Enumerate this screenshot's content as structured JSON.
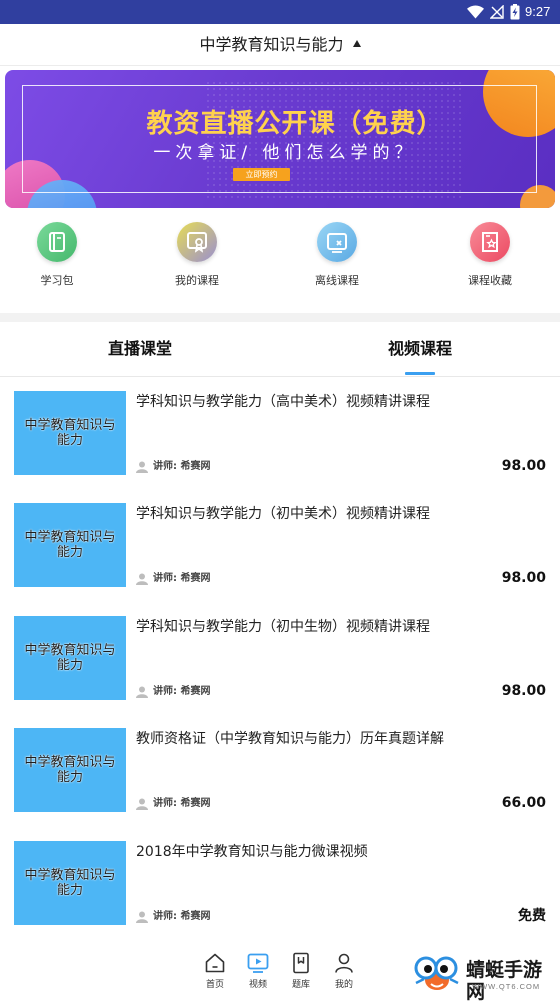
{
  "status_bar": {
    "time": "9:27",
    "icons": [
      "wifi-icon",
      "no-signal-icon",
      "battery-charging-icon"
    ]
  },
  "header": {
    "title": "中学教育知识与能力",
    "toggle_icon": "caret-up-icon"
  },
  "banner": {
    "title": "教资直播公开课（免费）",
    "subtitle": "一次拿证/ 他们怎么学的？",
    "button_label": "立即预约"
  },
  "shortcuts": [
    {
      "label": "学习包",
      "icon": "study-pack-icon",
      "color_from": "#7ad99a",
      "color_to": "#45b86c"
    },
    {
      "label": "我的课程",
      "icon": "my-courses-icon",
      "color_from": "#e6dc55",
      "color_to": "#9a8fd0"
    },
    {
      "label": "离线课程",
      "icon": "offline-courses-icon",
      "color_from": "#9ad6f5",
      "color_to": "#5aa9e3"
    },
    {
      "label": "课程收藏",
      "icon": "favorites-icon",
      "color_from": "#f88c98",
      "color_to": "#ec4a62"
    }
  ],
  "tabs": [
    {
      "label": "直播课堂",
      "active": false
    },
    {
      "label": "视频课程",
      "active": true
    }
  ],
  "courses": [
    {
      "thumbnail_text": "中学教育知识与能力",
      "title": "学科知识与教学能力（高中美术）视频精讲课程",
      "teacher": "讲师: 希赛网",
      "price": "98.00"
    },
    {
      "thumbnail_text": "中学教育知识与能力",
      "title": "学科知识与教学能力（初中美术）视频精讲课程",
      "teacher": "讲师: 希赛网",
      "price": "98.00"
    },
    {
      "thumbnail_text": "中学教育知识与能力",
      "title": "学科知识与教学能力（初中生物）视频精讲课程",
      "teacher": "讲师: 希赛网",
      "price": "98.00"
    },
    {
      "thumbnail_text": "中学教育知识与能力",
      "title": "教师资格证（中学教育知识与能力）历年真题详解",
      "teacher": "讲师: 希赛网",
      "price": "66.00"
    },
    {
      "thumbnail_text": "中学教育知识与能力",
      "title": "2018年中学教育知识与能力微课视频",
      "teacher": "讲师: 希赛网",
      "price": "免费"
    }
  ],
  "bottom_nav": [
    {
      "label": "首页",
      "icon": "home-icon",
      "active": false
    },
    {
      "label": "视频",
      "icon": "video-icon",
      "active": true
    },
    {
      "label": "题库",
      "icon": "question-bank-icon",
      "active": false
    },
    {
      "label": "我的",
      "icon": "profile-icon",
      "active": false
    }
  ],
  "watermark": {
    "name": "蜻蜓手游网",
    "url": "WWW.QT6.COM"
  },
  "colors": {
    "status_bar": "#303f9f",
    "accent": "#3a9ff0",
    "thumbnail": "#4db6f5",
    "banner_title": "#ffd24d",
    "banner_button": "#f6a21e",
    "divider_band": "#f2f2f2"
  }
}
